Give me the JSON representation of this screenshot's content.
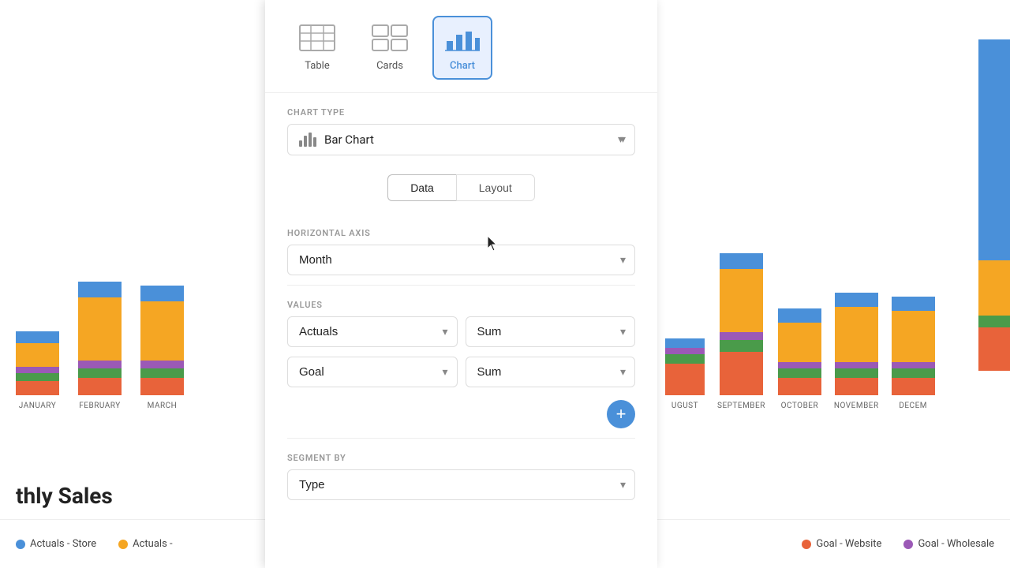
{
  "panel": {
    "view_options": [
      {
        "id": "table",
        "label": "Table"
      },
      {
        "id": "cards",
        "label": "Cards"
      },
      {
        "id": "chart",
        "label": "Chart",
        "active": true
      }
    ],
    "chart_type_label": "CHART TYPE",
    "chart_type_value": "Bar Chart",
    "tabs": [
      {
        "id": "data",
        "label": "Data",
        "active": true
      },
      {
        "id": "layout",
        "label": "Layout",
        "active": false
      }
    ],
    "horizontal_axis_label": "HORIZONTAL AXIS",
    "horizontal_axis_value": "Month",
    "values_label": "VALUES",
    "actuals_value": "Actuals",
    "actuals_agg": "Sum",
    "goal_value": "Goal",
    "goal_agg": "Sum",
    "segment_by_label": "SEGMENT BY",
    "segment_by_value": "Type",
    "add_button_label": "+"
  },
  "chart": {
    "title": "thly Sales",
    "months_left": [
      "JANUARY",
      "FEBRUARY",
      "MARCH"
    ],
    "months_right": [
      "UGUST",
      "SEPTEMBER",
      "OCTOBER",
      "NOVEMBER",
      "DECEM"
    ],
    "legend": [
      {
        "label": "Actuals - Store",
        "color": "#4a90d9"
      },
      {
        "label": "Actuals -",
        "color": "#f5a623"
      },
      {
        "label": "Goal - Website",
        "color": "#e8633a"
      },
      {
        "label": "Goal - Wholesale",
        "color": "#9b59b6"
      }
    ]
  }
}
